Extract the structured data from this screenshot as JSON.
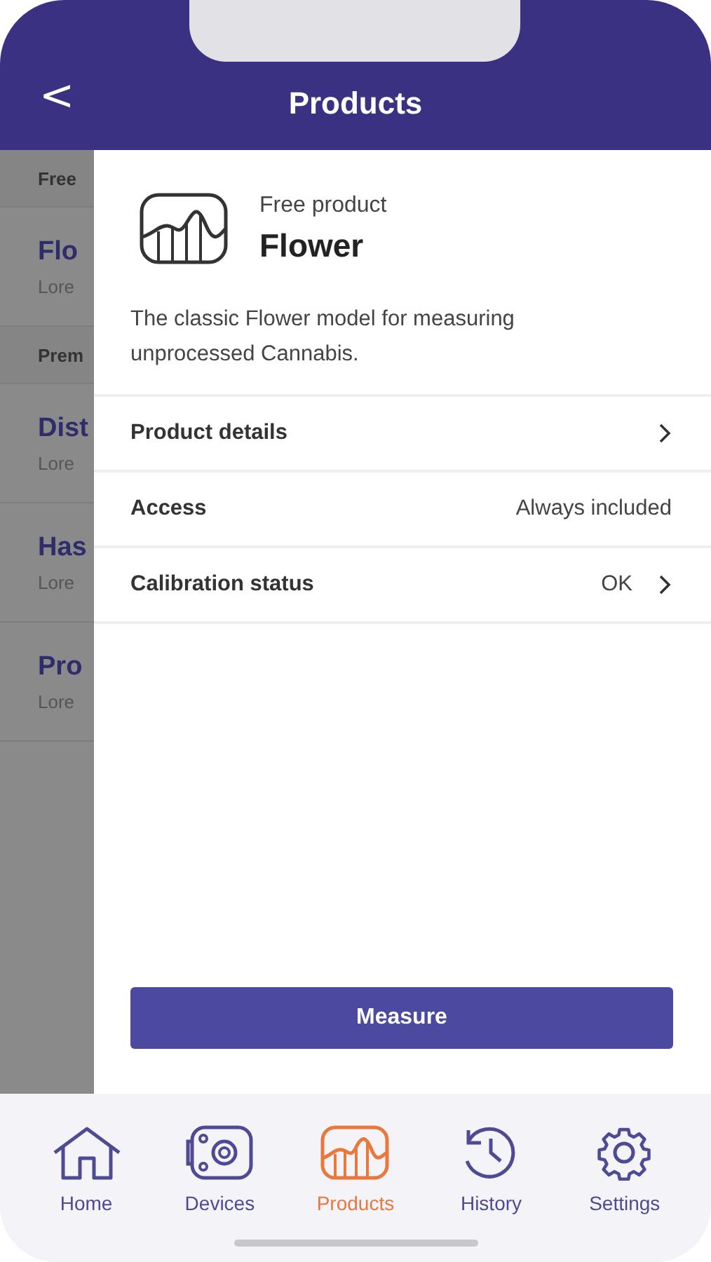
{
  "header": {
    "back": "<",
    "title": "Products"
  },
  "background_list": [
    {
      "kind": "section",
      "text": "Free"
    },
    {
      "kind": "item",
      "title": "Flo",
      "subtitle": "Lore"
    },
    {
      "kind": "section",
      "text": "Prem"
    },
    {
      "kind": "item",
      "title": "Dist",
      "subtitle": "Lore"
    },
    {
      "kind": "item",
      "title": "Has",
      "subtitle": "Lore"
    },
    {
      "kind": "item",
      "title": "Pro",
      "subtitle": "Lore"
    }
  ],
  "product": {
    "category": "Free product",
    "name": "Flower",
    "description": "The classic Flower model for measuring unprocessed Cannabis."
  },
  "rows": [
    {
      "label": "Product details",
      "chevron": true
    },
    {
      "label": "Access",
      "value": "Always included",
      "chevron": false
    },
    {
      "label": "Calibration status",
      "value": "OK",
      "chevron": true
    }
  ],
  "action_button": "Measure",
  "tabs": [
    {
      "kind": "home",
      "label": "Home",
      "selected": false
    },
    {
      "kind": "devices",
      "label": "Devices",
      "selected": false
    },
    {
      "kind": "products",
      "label": "Products",
      "selected": true
    },
    {
      "kind": "history",
      "label": "History",
      "selected": false
    },
    {
      "kind": "settings",
      "label": "Settings",
      "selected": false
    }
  ]
}
